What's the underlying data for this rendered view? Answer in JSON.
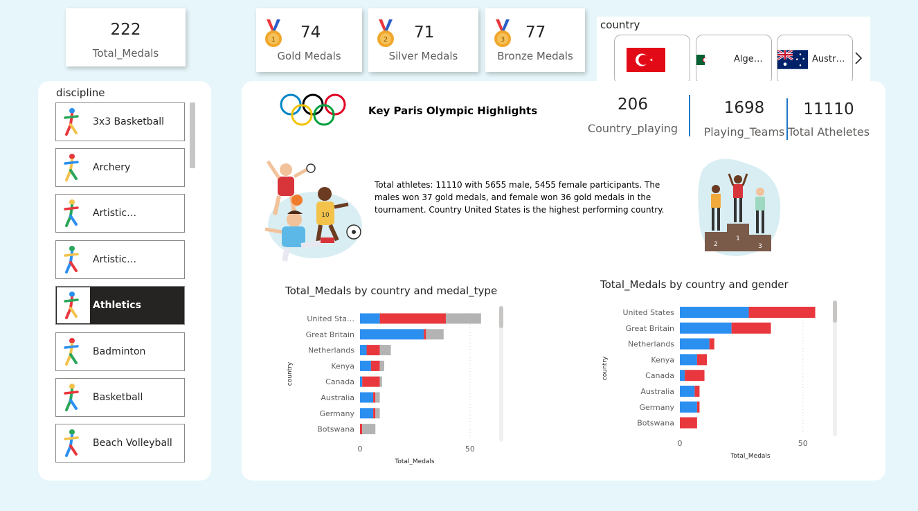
{
  "kpis": {
    "total": {
      "value": "222",
      "label": "Total_Medals"
    },
    "gold": {
      "value": "74",
      "label": "Gold Medals"
    },
    "silver": {
      "value": "71",
      "label": "Silver Medals"
    },
    "bronze": {
      "value": "77",
      "label": "Bronze Medals"
    }
  },
  "country_slicer": {
    "title": "country",
    "items": [
      {
        "name": "",
        "flag": "turkey-flag"
      },
      {
        "name": "Alge…",
        "flag": "algeria-flag"
      },
      {
        "name": "Austr…",
        "flag": "australia-flag"
      }
    ],
    "next_icon": "chevron-right-icon"
  },
  "discipline_slicer": {
    "title": "discipline",
    "selected": "Athletics",
    "items": [
      {
        "label": "3x3 Basketball",
        "icon": "basketball-icon"
      },
      {
        "label": "Archery",
        "icon": "archery-icon"
      },
      {
        "label": "Artistic…",
        "icon": "gymnastics-icon"
      },
      {
        "label": "Artistic…",
        "icon": "swimming-icon"
      },
      {
        "label": "Athletics",
        "icon": "running-icon"
      },
      {
        "label": "Badminton",
        "icon": "badminton-icon"
      },
      {
        "label": "Basketball",
        "icon": "basketball-icon"
      },
      {
        "label": "Beach Volleyball",
        "icon": "volleyball-icon"
      }
    ]
  },
  "highlights": {
    "title": "Key Paris Olympic Highlights",
    "stats": [
      {
        "value": "206",
        "label": "Country_playing"
      },
      {
        "value": "1698",
        "label": "Playing_Teams"
      },
      {
        "value": "11110",
        "label": "Total Atheletes"
      }
    ],
    "summary": "Total athletes: 11110 with 5655 male, 5455 female participants. The males won 37 gold medals, and female won 36 gold medals in the tournament. Country United States is the highest performing country.",
    "podium_labels": [
      "2",
      "1",
      "3"
    ]
  },
  "colors": {
    "blue": "#2b8ff0",
    "red": "#e8383d",
    "gray": "#b3b3b3",
    "ring_blue": "#0085c7",
    "ring_yellow": "#f4c300",
    "ring_black": "#000000",
    "ring_green": "#009f3d",
    "ring_red": "#df0024"
  },
  "chart_data": [
    {
      "type": "bar",
      "orientation": "horizontal",
      "stacked": true,
      "title": "Total_Medals by country and medal_type",
      "xlabel": "Total_Medals",
      "ylabel": "country",
      "xlim": [
        0,
        56
      ],
      "xticks": [
        0,
        50
      ],
      "categories": [
        "United Sta…",
        "Great Britain",
        "Netherlands",
        "Kenya",
        "Canada",
        "Australia",
        "Germany",
        "Botswana"
      ],
      "series": [
        {
          "color": "#2b8ff0",
          "values": [
            9,
            29,
            3,
            5,
            1,
            6,
            6,
            0
          ]
        },
        {
          "color": "#e8383d",
          "values": [
            30,
            1,
            6,
            4,
            8,
            1,
            1,
            1
          ]
        },
        {
          "color": "#b3b3b3",
          "values": [
            16,
            8,
            5,
            2,
            1,
            2,
            2,
            6
          ]
        }
      ]
    },
    {
      "type": "bar",
      "orientation": "horizontal",
      "stacked": true,
      "title": "Total_Medals by country and gender",
      "xlabel": "Total_Medals",
      "ylabel": "country",
      "xlim": [
        0,
        63
      ],
      "xticks": [
        0,
        50
      ],
      "categories": [
        "United States",
        "Great Britain",
        "Netherlands",
        "Kenya",
        "Canada",
        "Australia",
        "Germany",
        "Botswana"
      ],
      "series": [
        {
          "color": "#2b8ff0",
          "values": [
            28,
            21,
            12,
            7,
            2,
            6,
            7,
            0
          ]
        },
        {
          "color": "#e8383d",
          "values": [
            27,
            16,
            2,
            4,
            8,
            2,
            1,
            7
          ]
        }
      ]
    }
  ]
}
